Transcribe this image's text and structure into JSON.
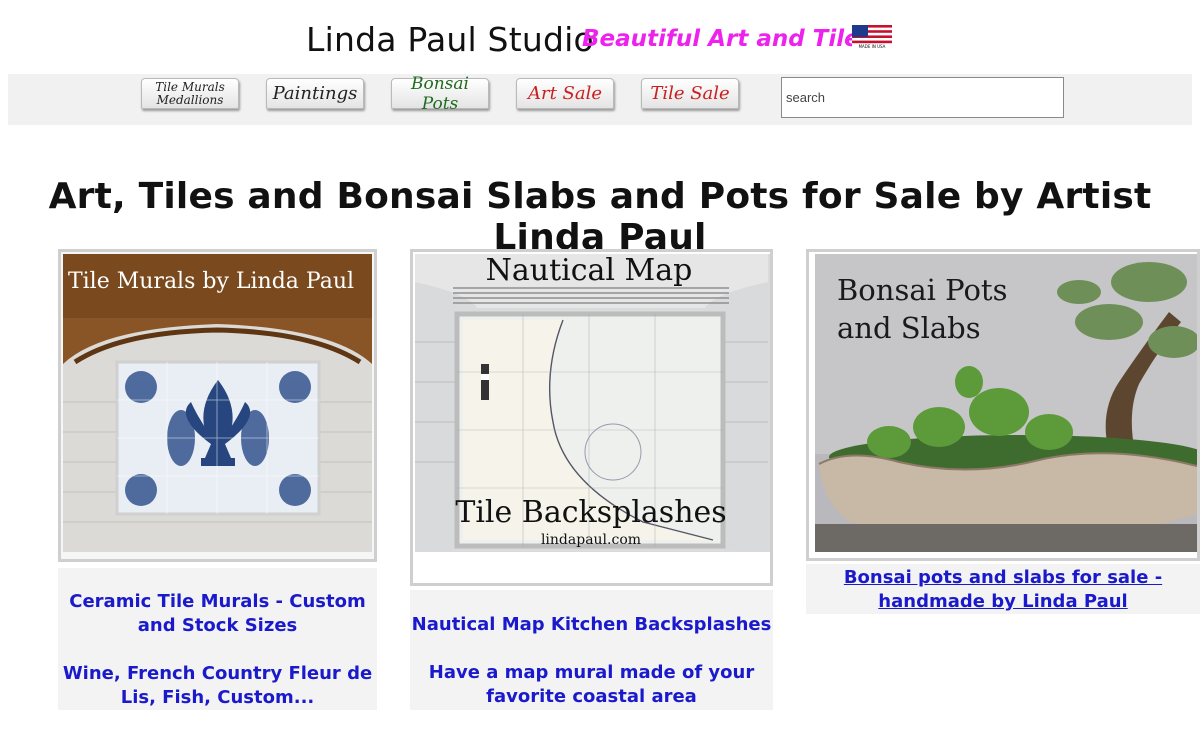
{
  "header": {
    "site_title": "Linda Paul Studio",
    "tagline": "Beautiful Art and Tile",
    "flag_caption": "MADE IN USA"
  },
  "nav": {
    "items": [
      {
        "label_line1": "Tile Murals",
        "label_line2": "Medallions",
        "color": "#222222"
      },
      {
        "label": "Paintings",
        "color": "#222222"
      },
      {
        "label": "Bonsai Pots",
        "color": "#1f6b1f"
      },
      {
        "label": "Art Sale",
        "color": "#c82020"
      },
      {
        "label": "Tile Sale",
        "color": "#c82020"
      }
    ],
    "search_placeholder": "search"
  },
  "main": {
    "heading": "Art, Tiles and Bonsai Slabs and Pots for Sale by Artist Linda Paul",
    "cards": [
      {
        "image_text": "Tile Murals by Linda Paul",
        "title": "Ceramic Tile Murals - Custom and Stock Sizes",
        "subtitle": "Wine, French Country Fleur de Lis, Fish, Custom..."
      },
      {
        "image_text_top": "Nautical Map",
        "image_text_bottom": "Tile Backsplashes",
        "image_text_url": "lindapaul.com",
        "title": "Nautical Map Kitchen Backsplashes",
        "subtitle": "Have a map mural made of your favorite coastal area"
      },
      {
        "image_text_line1": "Bonsai Pots",
        "image_text_line2": "and Slabs",
        "title": "Bonsai pots and slabs for sale - handmade by Linda Paul"
      }
    ]
  }
}
